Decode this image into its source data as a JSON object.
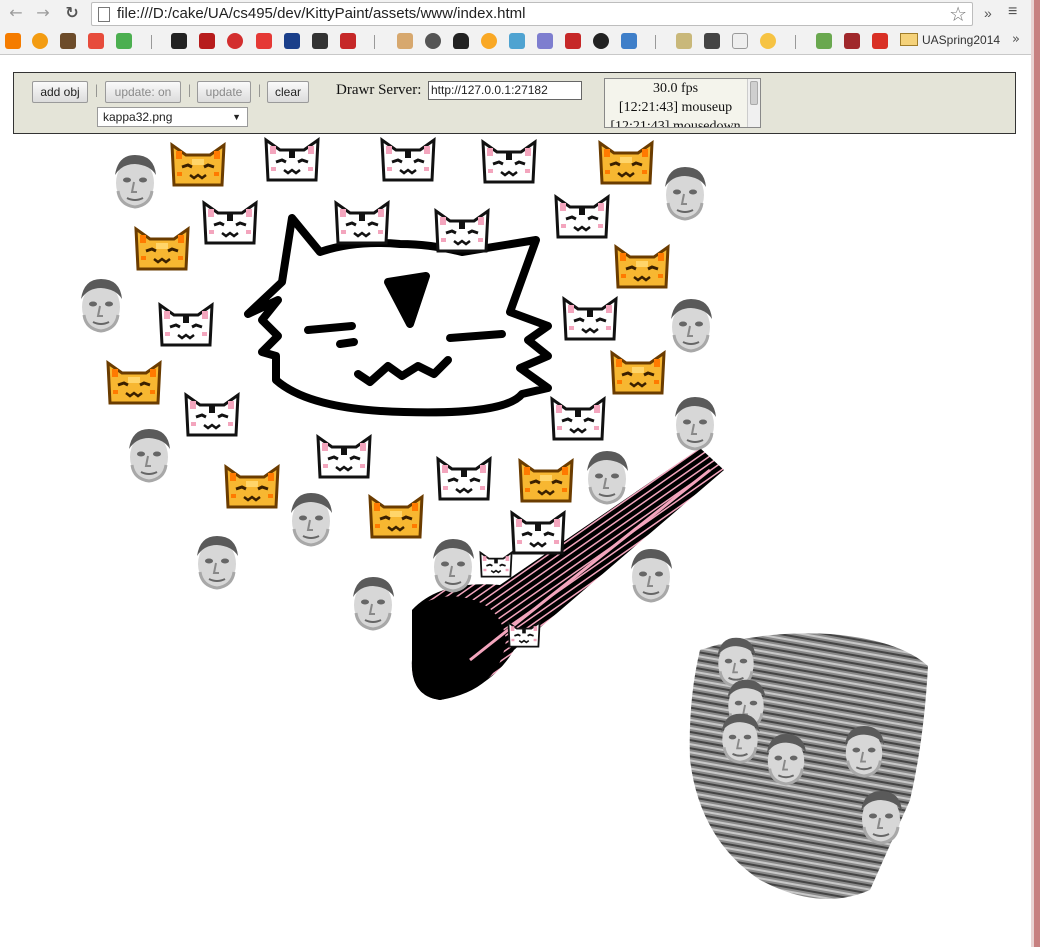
{
  "browser": {
    "url": "file:///D:/cake/UA/cs495/dev/KittyPaint/assets/www/index.html",
    "back_icon": "back-arrow-icon",
    "forward_icon": "forward-arrow-icon",
    "reload_icon": "reload-icon",
    "star_icon": "star-icon",
    "overflow_label": "»",
    "menu_icon": "hamburger-menu-icon"
  },
  "bookmarks": {
    "folder_label": "UASpring2014",
    "more_label": "»",
    "items": [
      "soundcloud",
      "origin",
      "box",
      "app",
      "chat",
      "kdenlive",
      "k",
      "bull",
      "d",
      "paypal",
      "cube",
      "mega",
      "pe",
      "news",
      "tux",
      "sun",
      "drop",
      "link",
      "cpp",
      "github",
      "f",
      "g",
      "tv",
      "w",
      "ball",
      "ly",
      "house",
      "gmail"
    ]
  },
  "toolbar": {
    "add_obj_label": "add obj",
    "sep1": "|",
    "update_toggle_label": "update: on",
    "sep2": "|",
    "update_label": "update",
    "sep3": "|",
    "clear_label": "clear",
    "selected_image": "kappa32.png",
    "server_label": "Drawr Server:",
    "server_value": "http://127.0.0.1:27182"
  },
  "log": {
    "lines": [
      "30.0 fps",
      "[12:21:43] mouseup",
      "[12:21:43] mousedown"
    ]
  },
  "canvas": {
    "sprites": {
      "kappa": "kappa-face-sprite",
      "white_cat": "white-pixel-cat-sprite",
      "orange_cat": "orange-pixel-cat-sprite"
    },
    "colors": {
      "orange": "#f5a623",
      "pink": "#f6b8c9",
      "black": "#000000"
    }
  }
}
